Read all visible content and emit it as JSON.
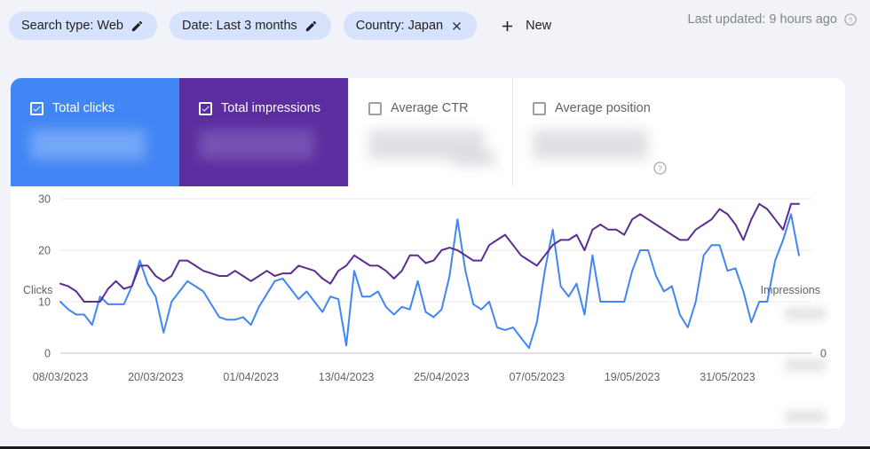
{
  "filters": {
    "chips": [
      {
        "label": "Search type: Web",
        "icon": "edit-icon",
        "name": "filter-chip-search-type"
      },
      {
        "label": "Date: Last 3 months",
        "icon": "edit-icon",
        "name": "filter-chip-date"
      },
      {
        "label": "Country: Japan",
        "icon": "close-icon",
        "name": "filter-chip-country"
      }
    ],
    "new_label": "New",
    "plus_icon": "plus-icon"
  },
  "status": {
    "last_updated": "Last updated: 9 hours ago",
    "help_icon": "help-icon"
  },
  "metric_tabs": [
    {
      "label": "Total clicks",
      "checked": true,
      "value": "",
      "color": "#4285f4"
    },
    {
      "label": "Total impressions",
      "checked": true,
      "value": "",
      "color": "#5b2d9e"
    },
    {
      "label": "Average CTR",
      "checked": false,
      "value": "",
      "color": "#ffffff"
    },
    {
      "label": "Average position",
      "checked": false,
      "value": "",
      "color": "#ffffff"
    }
  ],
  "tab_help_icon": "help-icon",
  "chart_data": {
    "type": "line",
    "title": "",
    "xlabel": "",
    "ylabel": "Clicks",
    "y2label": "Impressions",
    "ylim": [
      0,
      30
    ],
    "yticks": [
      0,
      10,
      20,
      30
    ],
    "y2ticks_visible": [
      "0"
    ],
    "grid": true,
    "legend": "top-tabs",
    "xtick_labels": [
      "08/03/2023",
      "20/03/2023",
      "01/04/2023",
      "13/04/2023",
      "25/04/2023",
      "07/05/2023",
      "19/05/2023",
      "31/05/2023"
    ],
    "xtick_indices": [
      0,
      12,
      24,
      36,
      48,
      60,
      72,
      84
    ],
    "series": [
      {
        "name": "Total clicks",
        "color": "#4285f4",
        "values": [
          10,
          8.5,
          7.5,
          7.5,
          5.5,
          11,
          9.5,
          9.5,
          9.5,
          13,
          18,
          13.5,
          11,
          4,
          10,
          12,
          14,
          13,
          12,
          9.5,
          7,
          6.5,
          6.5,
          7,
          5.5,
          9,
          11.5,
          14,
          14.5,
          12.5,
          10.5,
          12,
          10,
          8,
          11,
          10.5,
          1.5,
          16,
          11,
          11,
          12,
          9,
          7.5,
          9,
          8.5,
          14,
          8,
          7,
          8.5,
          15,
          26,
          16,
          9.5,
          8.5,
          10,
          5,
          4.5,
          5,
          3,
          1,
          6,
          16,
          24,
          13,
          11,
          13.5,
          7.5,
          19,
          10,
          10,
          10,
          10,
          16,
          20,
          20,
          15,
          12,
          13,
          7.5,
          5,
          10,
          19,
          21,
          21,
          16,
          16.5,
          12,
          6,
          10,
          10,
          18,
          22,
          27,
          19
        ]
      },
      {
        "name": "Total impressions",
        "color": "#5c2d91",
        "values": [
          13.5,
          13,
          12,
          10,
          10,
          10,
          12.5,
          14,
          12.5,
          13,
          17,
          17,
          15,
          14,
          15,
          18,
          18,
          17,
          16,
          15.5,
          15,
          15,
          16,
          15,
          14,
          15,
          16,
          15,
          15.5,
          15.5,
          17,
          16.5,
          16,
          14.5,
          13.5,
          16,
          17,
          19,
          18,
          17,
          17,
          16,
          14.5,
          16,
          19,
          19,
          17.5,
          18,
          20,
          20.5,
          20,
          19,
          18,
          18,
          21,
          22,
          23,
          21,
          19,
          18,
          17,
          19,
          21,
          22,
          22,
          23,
          20,
          24,
          25,
          24,
          24,
          23,
          26,
          27,
          26,
          25,
          24,
          23,
          22,
          22,
          24,
          25,
          26,
          28,
          27,
          25,
          22,
          26,
          29,
          28,
          26,
          24,
          29,
          29
        ]
      }
    ]
  }
}
